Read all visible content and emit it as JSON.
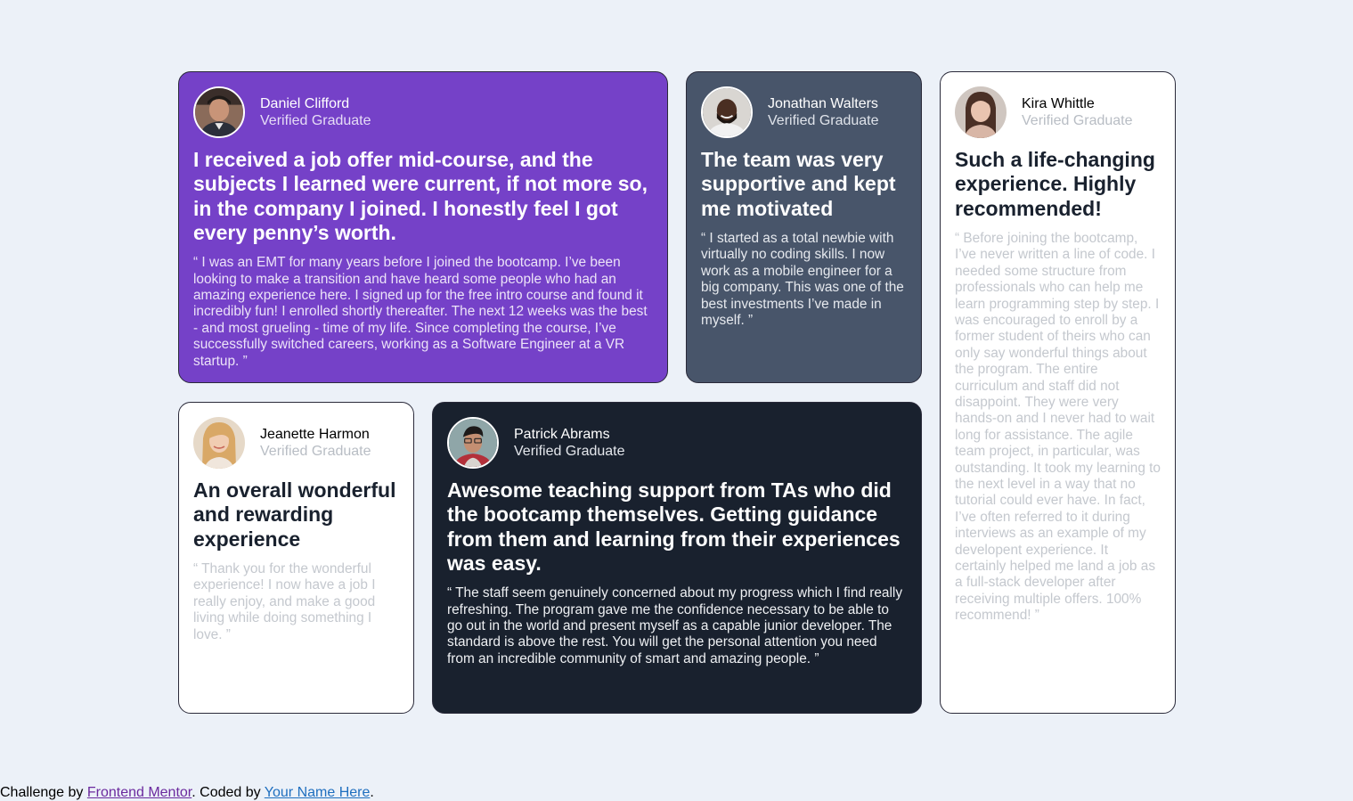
{
  "testimonials": [
    {
      "name": "Daniel Clifford",
      "role": "Verified Graduate",
      "avatar_icon": "avatar-daniel-icon",
      "headline": "I received a job offer mid-course, and the subjects I learned were current, if not more so, in the company I joined. I honestly feel I got every penny’s worth.",
      "quote": "“ I was an EMT for many years before I joined the bootcamp. I’ve been looking to make a transition and have heard some people who had an amazing experience here. I signed up for the free intro course and found it incredibly fun! I enrolled shortly thereafter. The next 12 weeks was the best - and most grueling - time of my life. Since completing the course, I’ve successfully switched careers, working as a Software Engineer at a VR startup. ”",
      "bg_color": "#7541c8"
    },
    {
      "name": "Jonathan Walters",
      "role": "Verified Graduate",
      "avatar_icon": "avatar-jonathan-icon",
      "headline": "The team was very supportive and kept me motivated",
      "quote": "“ I started as a total newbie with virtually no coding skills. I now work as a mobile engineer for a big company. This was one of the best investments I’ve made in myself. ”",
      "bg_color": "#48556a"
    },
    {
      "name": "Kira Whittle",
      "role": "Verified Graduate",
      "avatar_icon": "avatar-kira-icon",
      "headline": "Such a life-changing experience. Highly recommended!",
      "quote": "“ Before joining the bootcamp, I’ve never written a line of code. I needed some structure from professionals who can help me learn programming step by step. I was encouraged to enroll by a former student of theirs who can only say wonderful things about the program. The entire curriculum and staff did not disappoint. They were very hands-on and I never had to wait long for assistance. The agile team project, in particular, was outstanding. It took my learning to the next level in a way that no tutorial could ever have. In fact, I’ve often referred to it during interviews as an example of my developent experience. It certainly helped me land a job as a full-stack developer after receiving multiple offers. 100% recommend! ”",
      "bg_color": "#ffffff"
    },
    {
      "name": "Jeanette Harmon",
      "role": "Verified Graduate",
      "avatar_icon": "avatar-jeanette-icon",
      "headline": "An overall wonderful and rewarding experience",
      "quote": "“ Thank you for the wonderful experience! I now have a job I really enjoy, and make a good living while doing something I love. ”",
      "bg_color": "#ffffff"
    },
    {
      "name": "Patrick Abrams",
      "role": "Verified Graduate",
      "avatar_icon": "avatar-patrick-icon",
      "headline": "Awesome teaching support from TAs who did the bootcamp themselves. Getting guidance from them and learning from their experiences was easy.",
      "quote": "“ The staff seem genuinely concerned about my progress which I find really refreshing. The program gave me the confidence necessary to be able to go out in the world and present myself as a capable junior developer. The standard is above the rest. You will get the personal attention you need from an incredible community of smart and amazing people. ”",
      "bg_color": "#19212e"
    }
  ],
  "footer": {
    "prefix": "Challenge by ",
    "link1": "Frontend Mentor",
    "middle": ". Coded by ",
    "link2": "Your Name Here",
    "suffix": "."
  },
  "colors": {
    "page_bg": "#ecf1f8",
    "dark_text": "#19212e"
  }
}
